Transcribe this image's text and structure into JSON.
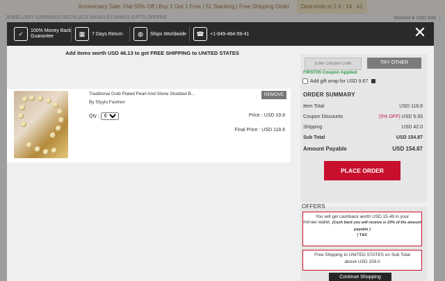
{
  "background": {
    "announcement": "Anniversary Sale: Flat 55% Off | Buy 1 Get 1 Free | 51 Stacking | Free Shipping Order",
    "deal_badge": "Deal ends in 1 d : 14 : 41",
    "top_right": "Wishlist ♥   USD   INR ⋮",
    "nav": "JEWELLERY   EARRINGS   NECKLACE   BANGLES   RINGS   GIFTS   OFFERS"
  },
  "header": {
    "items": [
      {
        "icon": "money-back-guarantee-icon",
        "glyph": "✓",
        "label": "100% Money Back Guarantee"
      },
      {
        "icon": "calendar-icon",
        "glyph": "▦",
        "label": "7 Days Return"
      },
      {
        "icon": "globe-icon",
        "glyph": "◍",
        "label": "Ships Worldwide"
      },
      {
        "icon": "phone-icon",
        "glyph": "☎",
        "label": "+1-949-464-59-41"
      }
    ],
    "close_label": "✕"
  },
  "cart": {
    "free_shipping_note": "Add items worth USD 46.13 to get FREE SHIPPING to UNITED STATES",
    "item": {
      "title": "Traditional Gold Plated Pearl And Stone Studded B...",
      "vendor": "By Styylo Fashion",
      "remove_label": "REMOVE",
      "qty_label": "Qty :",
      "qty_value": "6",
      "price_label": "Price : USD 19.8",
      "final_price_label": "Final Price : USD 118.8"
    }
  },
  "coupon": {
    "placeholder": "Enter Coupon Code",
    "try_other_label": "TRY OTHER",
    "applied_text": "FIRST05 Coupon Applied",
    "gift_wrap_label": "Add gift wrap for USD 9.67"
  },
  "summary": {
    "title": "ORDER SUMMARY",
    "item_total_label": "Item Total",
    "item_total_value": "USD 118.8",
    "coupon_label": "Coupon Discounts",
    "coupon_pct": "(5% OFF)",
    "coupon_value": "USD 5.93",
    "shipping_label": "Shipping",
    "shipping_value": "USD 42.0",
    "subtotal_label": "Sub Total",
    "subtotal_value": "USD 154.87",
    "payable_label": "Amount Payable",
    "payable_value": "USD 154.87",
    "place_order_label": "PLACE ORDER"
  },
  "offers": {
    "title": "OFFERS",
    "cashback_line1": "You will get cashback worth USD 15.49 in your",
    "cashback_line2": "mirraw wallet.",
    "cashback_note": "(Cash back you will receive is 10% of the amount payable )",
    "tc": "| T&C",
    "shipping_line1": "Free Shipping to UNITED STATES on Sub Total",
    "shipping_line2": "above USD 159.0",
    "continue_label": "Continue Shopping"
  },
  "colors": {
    "accent": "#c8102e",
    "success": "#2a9b4a",
    "header_bg": "#2a2a2a"
  }
}
